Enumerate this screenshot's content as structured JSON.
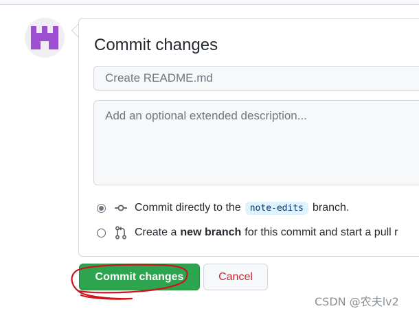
{
  "commit_form": {
    "title": "Commit changes",
    "summary_placeholder": "Create README.md",
    "description_placeholder": "Add an optional extended description...",
    "options": [
      {
        "selected": true,
        "text_before": "Commit directly to the",
        "branch": "note-edits",
        "text_after": "branch."
      },
      {
        "selected": false,
        "text_before": "Create a",
        "bold": "new branch",
        "text_after": "for this commit and start a pull r"
      }
    ],
    "commit_button": "Commit changes",
    "cancel_button": "Cancel"
  },
  "watermark": "CSDN @农夫lv2",
  "colors": {
    "primary_button": "#2da44e",
    "cancel_text": "#cf222e",
    "avatar": "#9c4fd1",
    "annotation_ring": "#d0121b"
  },
  "icons": {
    "avatar": "identicon",
    "option_1": "git-commit-icon",
    "option_2": "git-pull-request-icon"
  }
}
